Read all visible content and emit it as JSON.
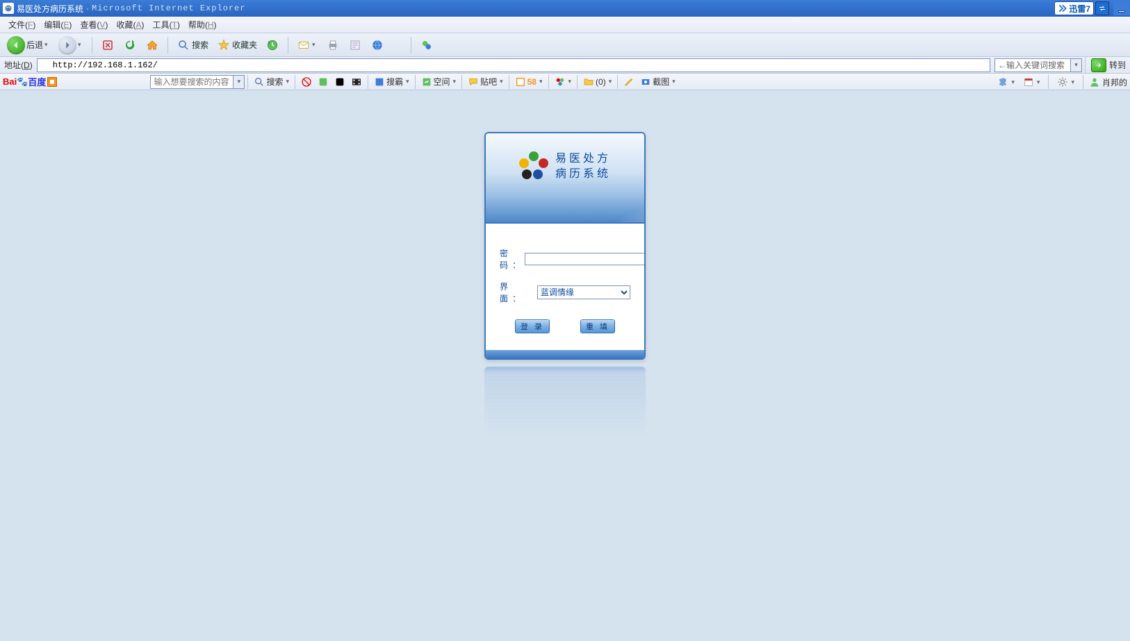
{
  "titlebar": {
    "app_title": "易医处方病历系统",
    "suffix": "Microsoft Internet Explorer",
    "xunlei_label": "迅雷7"
  },
  "menubar": {
    "items": [
      {
        "label": "文件",
        "accel": "F"
      },
      {
        "label": "编辑",
        "accel": "E"
      },
      {
        "label": "查看",
        "accel": "V"
      },
      {
        "label": "收藏",
        "accel": "A"
      },
      {
        "label": "工具",
        "accel": "T"
      },
      {
        "label": "帮助",
        "accel": "H"
      }
    ]
  },
  "toolbar": {
    "back_label": "后退",
    "search_label": "搜索",
    "favorites_label": "收藏夹"
  },
  "addressbar": {
    "label": "地址",
    "accel": "D",
    "url": "http://192.168.1.162/",
    "right_search_placeholder": "←输入关键词搜索",
    "go_label": "转到"
  },
  "baidubar": {
    "logo_bai": "Bai",
    "logo_du": "百度",
    "search_placeholder": "输入想要搜索的内容",
    "search_btn": "搜索",
    "souba": "搜霸",
    "space": "空间",
    "tieba": "贴吧",
    "num58": "58",
    "count0": "(0)",
    "jietu": "截图",
    "username": "肖邦的"
  },
  "login": {
    "title_line1": "易医处方",
    "title_line2": "病历系统",
    "password_label": "密 码：",
    "theme_label": "界 面：",
    "theme_value": "蓝调情缘",
    "login_btn": "登 录",
    "reset_btn": "重 填"
  }
}
